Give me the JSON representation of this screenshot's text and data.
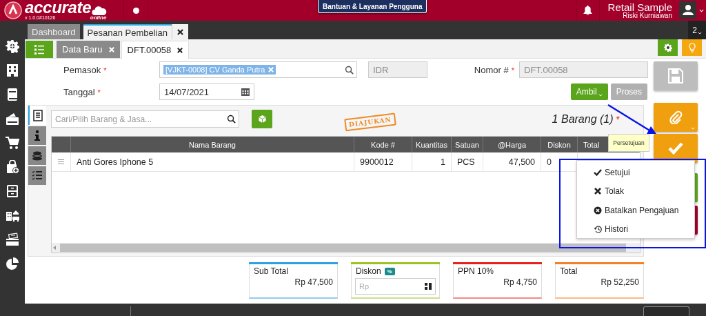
{
  "app": {
    "brand": "accurate",
    "brand_sub": "online",
    "version": "v 1.0.0#10126"
  },
  "header": {
    "help_button": "Bantuan & Layanan Pengguna",
    "company": "Retail Sample",
    "user": "Riski Kurniawan"
  },
  "main_tabs": [
    {
      "label": "Dashboard",
      "selected": false,
      "closable": false
    },
    {
      "label": "Pesanan Pembelian",
      "selected": true,
      "closable": true
    }
  ],
  "open_count": "2",
  "doc_tabs": [
    {
      "label": "Data Baru",
      "selected": false
    },
    {
      "label": "DFT.00058",
      "selected": true
    }
  ],
  "form": {
    "supplier": {
      "label": "Pemasok",
      "mark": "*",
      "value": "[VJKT-0008] CV Ganda Putra"
    },
    "currency": {
      "value": "IDR"
    },
    "date": {
      "label": "Tanggal",
      "mark": "*",
      "value": "14/07/2021"
    },
    "number": {
      "label": "Nomor #",
      "mark": "*",
      "value": "DFT.00058"
    },
    "buttons": [
      {
        "label": "Ambil",
        "kind": "dropdown"
      },
      {
        "label": "Proses",
        "kind": "plain"
      }
    ]
  },
  "side_tabs": [
    {
      "kind": "list",
      "selected": true
    },
    {
      "kind": "info",
      "selected": false
    },
    {
      "kind": "coins",
      "selected": false
    },
    {
      "kind": "checklist",
      "selected": false
    }
  ],
  "items": {
    "search": {
      "placeholder": "Cari/Pilih Barang & Jasa..."
    },
    "stamp": "DIAJUKAN",
    "count": "1 Barang (1)",
    "count_mark": "*",
    "table": {
      "columns": [
        "Nama Barang",
        "Kode #",
        "Kuantitas",
        "Satuan",
        "@Harga",
        "Diskon",
        "Total"
      ],
      "rows": [
        {
          "cells": [
            "Anti Gores Iphone 5",
            "9900012",
            "1",
            "PCS",
            "47,500",
            "0"
          ]
        }
      ]
    }
  },
  "summary": [
    {
      "kind": "value",
      "label": "Sub Total",
      "value": "Rp 47,500",
      "color": "#29a3e0"
    },
    {
      "kind": "input",
      "label": "Diskon",
      "badge": "%",
      "placeholder": "Rp",
      "color": "#9cc222"
    },
    {
      "kind": "value",
      "label": "PPN 10%",
      "value": "Rp 4,750",
      "color": "#e8211d"
    },
    {
      "kind": "value",
      "label": "Total",
      "value": "Rp 52,250",
      "color": "#f5801f"
    }
  ],
  "tooltip": "Persetujuan",
  "approval_menu": [
    {
      "kind": "approve",
      "label": "Setujui"
    },
    {
      "kind": "reject",
      "label": "Tolak"
    },
    {
      "kind": "cancel",
      "label": "Batalkan Pengajuan"
    },
    {
      "kind": "history",
      "label": "Histori"
    }
  ]
}
